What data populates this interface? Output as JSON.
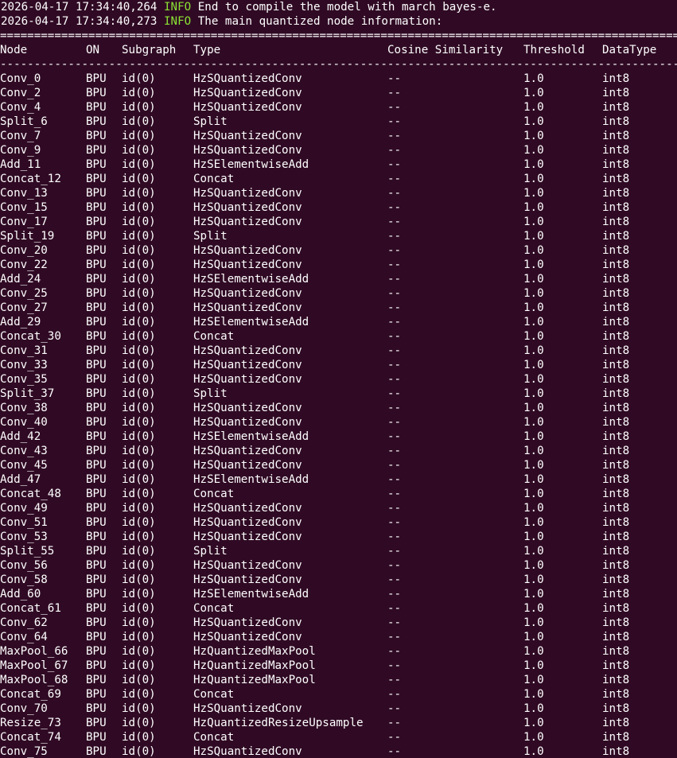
{
  "colors": {
    "background": "#300a24",
    "text": "#ffffff",
    "info_level": "#8ae234"
  },
  "log_lines": [
    {
      "timestamp": "2026-04-17 17:34:40,264",
      "level": "INFO",
      "message": "End to compile the model with march bayes-e."
    },
    {
      "timestamp": "2026-04-17 17:34:40,273",
      "level": "INFO",
      "message": "The main quantized node information:"
    }
  ],
  "separator_char": "=",
  "dash_char": "-",
  "table": {
    "headers": {
      "node": "Node",
      "on": "ON",
      "subgraph": "Subgraph",
      "type": "Type",
      "cosine": "Cosine Similarity",
      "threshold": "Threshold",
      "datatype": "DataType"
    },
    "rows": [
      {
        "node": "Conv_0",
        "on": "BPU",
        "subgraph": "id(0)",
        "type": "HzSQuantizedConv",
        "cosine": "--",
        "threshold": "1.0",
        "datatype": "int8"
      },
      {
        "node": "Conv_2",
        "on": "BPU",
        "subgraph": "id(0)",
        "type": "HzSQuantizedConv",
        "cosine": "--",
        "threshold": "1.0",
        "datatype": "int8"
      },
      {
        "node": "Conv_4",
        "on": "BPU",
        "subgraph": "id(0)",
        "type": "HzSQuantizedConv",
        "cosine": "--",
        "threshold": "1.0",
        "datatype": "int8"
      },
      {
        "node": "Split_6",
        "on": "BPU",
        "subgraph": "id(0)",
        "type": "Split",
        "cosine": "--",
        "threshold": "1.0",
        "datatype": "int8"
      },
      {
        "node": "Conv_7",
        "on": "BPU",
        "subgraph": "id(0)",
        "type": "HzSQuantizedConv",
        "cosine": "--",
        "threshold": "1.0",
        "datatype": "int8"
      },
      {
        "node": "Conv_9",
        "on": "BPU",
        "subgraph": "id(0)",
        "type": "HzSQuantizedConv",
        "cosine": "--",
        "threshold": "1.0",
        "datatype": "int8"
      },
      {
        "node": "Add_11",
        "on": "BPU",
        "subgraph": "id(0)",
        "type": "HzSElementwiseAdd",
        "cosine": "--",
        "threshold": "1.0",
        "datatype": "int8"
      },
      {
        "node": "Concat_12",
        "on": "BPU",
        "subgraph": "id(0)",
        "type": "Concat",
        "cosine": "--",
        "threshold": "1.0",
        "datatype": "int8"
      },
      {
        "node": "Conv_13",
        "on": "BPU",
        "subgraph": "id(0)",
        "type": "HzSQuantizedConv",
        "cosine": "--",
        "threshold": "1.0",
        "datatype": "int8"
      },
      {
        "node": "Conv_15",
        "on": "BPU",
        "subgraph": "id(0)",
        "type": "HzSQuantizedConv",
        "cosine": "--",
        "threshold": "1.0",
        "datatype": "int8"
      },
      {
        "node": "Conv_17",
        "on": "BPU",
        "subgraph": "id(0)",
        "type": "HzSQuantizedConv",
        "cosine": "--",
        "threshold": "1.0",
        "datatype": "int8"
      },
      {
        "node": "Split_19",
        "on": "BPU",
        "subgraph": "id(0)",
        "type": "Split",
        "cosine": "--",
        "threshold": "1.0",
        "datatype": "int8"
      },
      {
        "node": "Conv_20",
        "on": "BPU",
        "subgraph": "id(0)",
        "type": "HzSQuantizedConv",
        "cosine": "--",
        "threshold": "1.0",
        "datatype": "int8"
      },
      {
        "node": "Conv_22",
        "on": "BPU",
        "subgraph": "id(0)",
        "type": "HzSQuantizedConv",
        "cosine": "--",
        "threshold": "1.0",
        "datatype": "int8"
      },
      {
        "node": "Add_24",
        "on": "BPU",
        "subgraph": "id(0)",
        "type": "HzSElementwiseAdd",
        "cosine": "--",
        "threshold": "1.0",
        "datatype": "int8"
      },
      {
        "node": "Conv_25",
        "on": "BPU",
        "subgraph": "id(0)",
        "type": "HzSQuantizedConv",
        "cosine": "--",
        "threshold": "1.0",
        "datatype": "int8"
      },
      {
        "node": "Conv_27",
        "on": "BPU",
        "subgraph": "id(0)",
        "type": "HzSQuantizedConv",
        "cosine": "--",
        "threshold": "1.0",
        "datatype": "int8"
      },
      {
        "node": "Add_29",
        "on": "BPU",
        "subgraph": "id(0)",
        "type": "HzSElementwiseAdd",
        "cosine": "--",
        "threshold": "1.0",
        "datatype": "int8"
      },
      {
        "node": "Concat_30",
        "on": "BPU",
        "subgraph": "id(0)",
        "type": "Concat",
        "cosine": "--",
        "threshold": "1.0",
        "datatype": "int8"
      },
      {
        "node": "Conv_31",
        "on": "BPU",
        "subgraph": "id(0)",
        "type": "HzSQuantizedConv",
        "cosine": "--",
        "threshold": "1.0",
        "datatype": "int8"
      },
      {
        "node": "Conv_33",
        "on": "BPU",
        "subgraph": "id(0)",
        "type": "HzSQuantizedConv",
        "cosine": "--",
        "threshold": "1.0",
        "datatype": "int8"
      },
      {
        "node": "Conv_35",
        "on": "BPU",
        "subgraph": "id(0)",
        "type": "HzSQuantizedConv",
        "cosine": "--",
        "threshold": "1.0",
        "datatype": "int8"
      },
      {
        "node": "Split_37",
        "on": "BPU",
        "subgraph": "id(0)",
        "type": "Split",
        "cosine": "--",
        "threshold": "1.0",
        "datatype": "int8"
      },
      {
        "node": "Conv_38",
        "on": "BPU",
        "subgraph": "id(0)",
        "type": "HzSQuantizedConv",
        "cosine": "--",
        "threshold": "1.0",
        "datatype": "int8"
      },
      {
        "node": "Conv_40",
        "on": "BPU",
        "subgraph": "id(0)",
        "type": "HzSQuantizedConv",
        "cosine": "--",
        "threshold": "1.0",
        "datatype": "int8"
      },
      {
        "node": "Add_42",
        "on": "BPU",
        "subgraph": "id(0)",
        "type": "HzSElementwiseAdd",
        "cosine": "--",
        "threshold": "1.0",
        "datatype": "int8"
      },
      {
        "node": "Conv_43",
        "on": "BPU",
        "subgraph": "id(0)",
        "type": "HzSQuantizedConv",
        "cosine": "--",
        "threshold": "1.0",
        "datatype": "int8"
      },
      {
        "node": "Conv_45",
        "on": "BPU",
        "subgraph": "id(0)",
        "type": "HzSQuantizedConv",
        "cosine": "--",
        "threshold": "1.0",
        "datatype": "int8"
      },
      {
        "node": "Add_47",
        "on": "BPU",
        "subgraph": "id(0)",
        "type": "HzSElementwiseAdd",
        "cosine": "--",
        "threshold": "1.0",
        "datatype": "int8"
      },
      {
        "node": "Concat_48",
        "on": "BPU",
        "subgraph": "id(0)",
        "type": "Concat",
        "cosine": "--",
        "threshold": "1.0",
        "datatype": "int8"
      },
      {
        "node": "Conv_49",
        "on": "BPU",
        "subgraph": "id(0)",
        "type": "HzSQuantizedConv",
        "cosine": "--",
        "threshold": "1.0",
        "datatype": "int8"
      },
      {
        "node": "Conv_51",
        "on": "BPU",
        "subgraph": "id(0)",
        "type": "HzSQuantizedConv",
        "cosine": "--",
        "threshold": "1.0",
        "datatype": "int8"
      },
      {
        "node": "Conv_53",
        "on": "BPU",
        "subgraph": "id(0)",
        "type": "HzSQuantizedConv",
        "cosine": "--",
        "threshold": "1.0",
        "datatype": "int8"
      },
      {
        "node": "Split_55",
        "on": "BPU",
        "subgraph": "id(0)",
        "type": "Split",
        "cosine": "--",
        "threshold": "1.0",
        "datatype": "int8"
      },
      {
        "node": "Conv_56",
        "on": "BPU",
        "subgraph": "id(0)",
        "type": "HzSQuantizedConv",
        "cosine": "--",
        "threshold": "1.0",
        "datatype": "int8"
      },
      {
        "node": "Conv_58",
        "on": "BPU",
        "subgraph": "id(0)",
        "type": "HzSQuantizedConv",
        "cosine": "--",
        "threshold": "1.0",
        "datatype": "int8"
      },
      {
        "node": "Add_60",
        "on": "BPU",
        "subgraph": "id(0)",
        "type": "HzSElementwiseAdd",
        "cosine": "--",
        "threshold": "1.0",
        "datatype": "int8"
      },
      {
        "node": "Concat_61",
        "on": "BPU",
        "subgraph": "id(0)",
        "type": "Concat",
        "cosine": "--",
        "threshold": "1.0",
        "datatype": "int8"
      },
      {
        "node": "Conv_62",
        "on": "BPU",
        "subgraph": "id(0)",
        "type": "HzSQuantizedConv",
        "cosine": "--",
        "threshold": "1.0",
        "datatype": "int8"
      },
      {
        "node": "Conv_64",
        "on": "BPU",
        "subgraph": "id(0)",
        "type": "HzSQuantizedConv",
        "cosine": "--",
        "threshold": "1.0",
        "datatype": "int8"
      },
      {
        "node": "MaxPool_66",
        "on": "BPU",
        "subgraph": "id(0)",
        "type": "HzQuantizedMaxPool",
        "cosine": "--",
        "threshold": "1.0",
        "datatype": "int8"
      },
      {
        "node": "MaxPool_67",
        "on": "BPU",
        "subgraph": "id(0)",
        "type": "HzQuantizedMaxPool",
        "cosine": "--",
        "threshold": "1.0",
        "datatype": "int8"
      },
      {
        "node": "MaxPool_68",
        "on": "BPU",
        "subgraph": "id(0)",
        "type": "HzQuantizedMaxPool",
        "cosine": "--",
        "threshold": "1.0",
        "datatype": "int8"
      },
      {
        "node": "Concat_69",
        "on": "BPU",
        "subgraph": "id(0)",
        "type": "Concat",
        "cosine": "--",
        "threshold": "1.0",
        "datatype": "int8"
      },
      {
        "node": "Conv_70",
        "on": "BPU",
        "subgraph": "id(0)",
        "type": "HzSQuantizedConv",
        "cosine": "--",
        "threshold": "1.0",
        "datatype": "int8"
      },
      {
        "node": "Resize_73",
        "on": "BPU",
        "subgraph": "id(0)",
        "type": "HzQuantizedResizeUpsample",
        "cosine": "--",
        "threshold": "1.0",
        "datatype": "int8"
      },
      {
        "node": "Concat_74",
        "on": "BPU",
        "subgraph": "id(0)",
        "type": "Concat",
        "cosine": "--",
        "threshold": "1.0",
        "datatype": "int8"
      },
      {
        "node": "Conv_75",
        "on": "BPU",
        "subgraph": "id(0)",
        "type": "HzSQuantizedConv",
        "cosine": "--",
        "threshold": "1.0",
        "datatype": "int8"
      }
    ]
  }
}
